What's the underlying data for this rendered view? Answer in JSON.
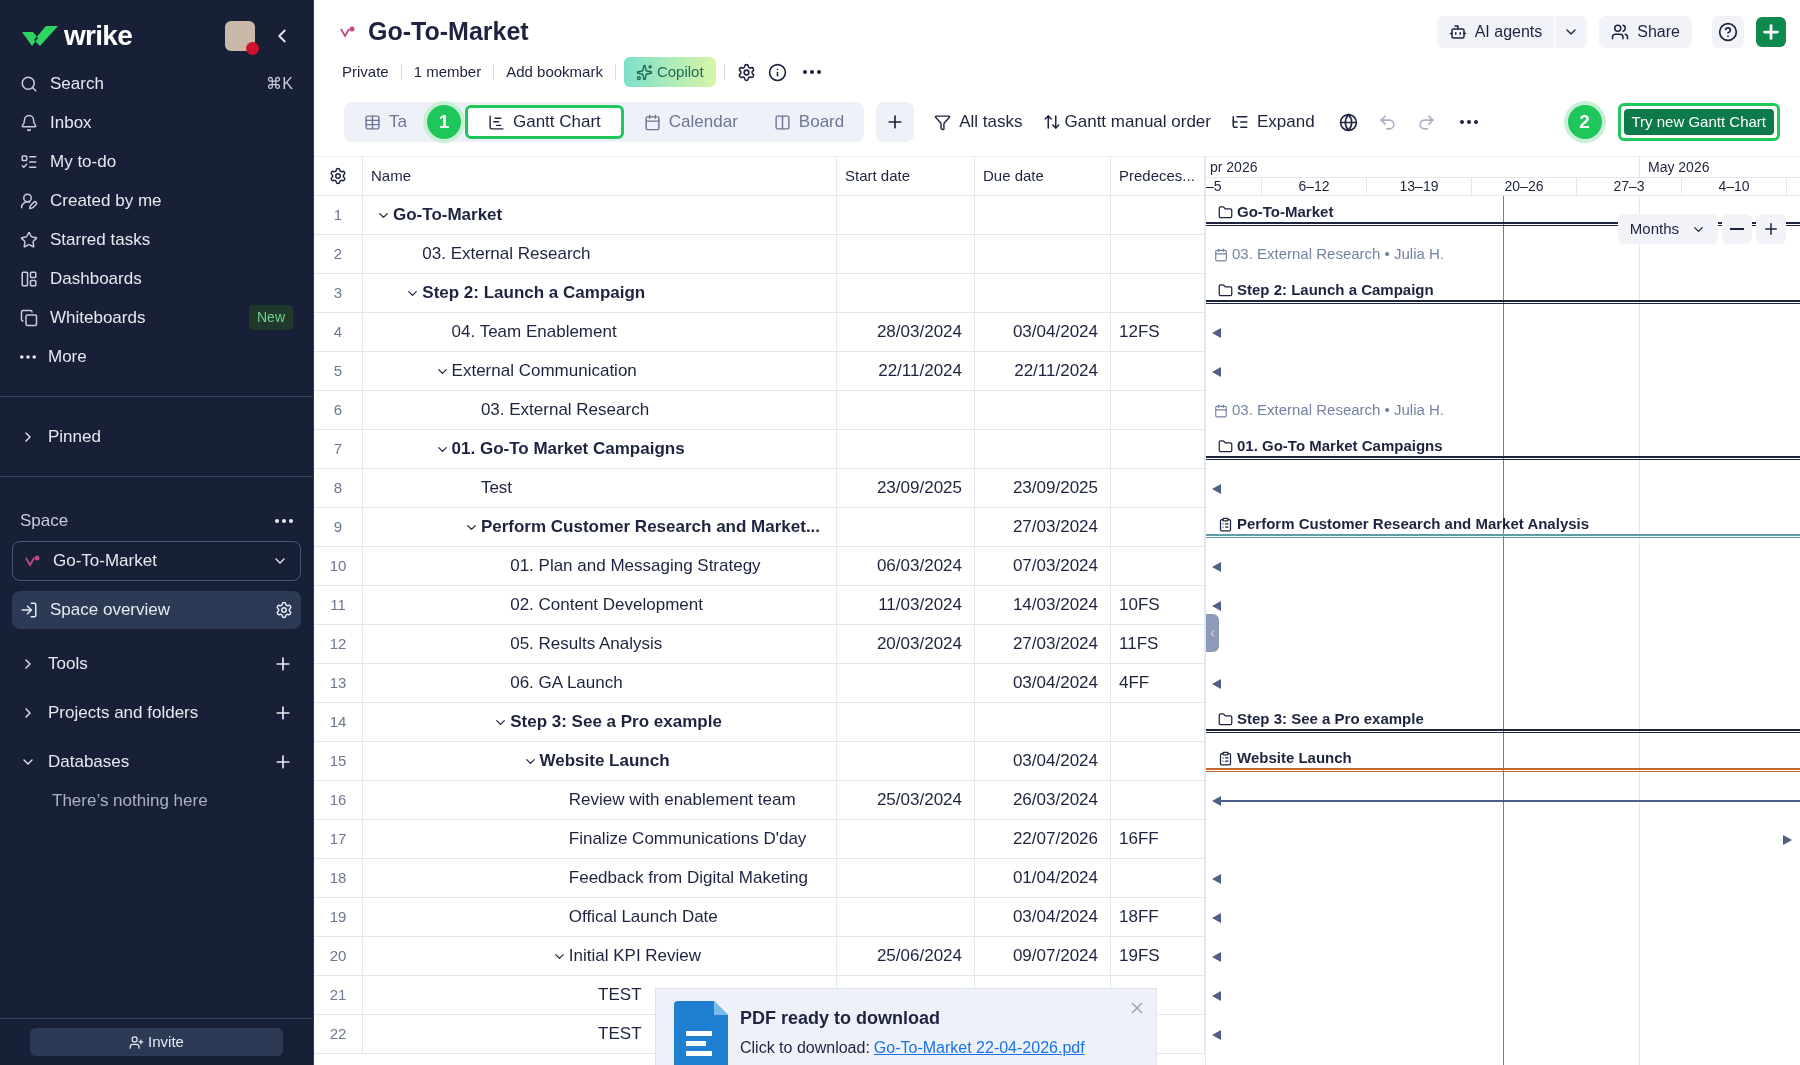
{
  "sidebar": {
    "logo": "wrike",
    "nav": [
      {
        "label": "Search",
        "shortcut": "⌘K"
      },
      {
        "label": "Inbox"
      },
      {
        "label": "My to-do"
      },
      {
        "label": "Created by me"
      },
      {
        "label": "Starred tasks"
      },
      {
        "label": "Dashboards"
      },
      {
        "label": "Whiteboards",
        "badge": "New"
      },
      {
        "label": "More"
      }
    ],
    "pinned": {
      "label": "Pinned",
      "expanded": false
    },
    "space": {
      "label": "Space",
      "current": "Go-To-Market",
      "overview": "Space overview"
    },
    "sections": [
      {
        "label": "Tools",
        "expanded": false
      },
      {
        "label": "Projects and folders",
        "expanded": false
      },
      {
        "label": "Databases",
        "expanded": true,
        "empty_text": "There’s nothing here"
      }
    ],
    "invite": "Invite"
  },
  "header": {
    "title": "Go-To-Market",
    "meta": [
      "Private",
      "1 member",
      "Add bookmark"
    ],
    "copilot": "Copilot",
    "ai_agents": "AI agents",
    "share": "Share"
  },
  "view_tabs": [
    {
      "kind": "table",
      "label": "Ta",
      "selected": false
    },
    {
      "kind": "gantt",
      "label": "Gantt Chart",
      "selected": true
    },
    {
      "kind": "calendar",
      "label": "Calendar",
      "selected": false
    },
    {
      "kind": "board",
      "label": "Board",
      "selected": false
    }
  ],
  "tour_badges": [
    "1",
    "2"
  ],
  "toolbar": {
    "filter": "All tasks",
    "sort": "Gantt manual order",
    "expand": "Expand",
    "try_new": "Try new Gantt Chart"
  },
  "table": {
    "columns": [
      "Name",
      "Start date",
      "Due date",
      "Predeces..."
    ],
    "rows": [
      {
        "num": "1",
        "name": "Go-To-Market",
        "bold": true,
        "expanded": true,
        "gantt": {
          "kind": "group",
          "label": "Go-To-Market",
          "color": "#1e2440"
        },
        "children": [
          {
            "num": "2",
            "name": "03. External Research",
            "gantt": {
              "kind": "milestone",
              "label": "03. External Research • Julia H."
            }
          },
          {
            "num": "3",
            "name": "Step 2: Launch a Campaign",
            "bold": true,
            "expanded": true,
            "gantt": {
              "kind": "group",
              "label": "Step 2: Launch a Campaign",
              "color": "#1e2440"
            },
            "children": [
              {
                "num": "4",
                "name": "04. Team Enablement",
                "start": "28/03/2024",
                "due": "03/04/2024",
                "pred": "12FS",
                "gantt": {
                  "kind": "before"
                }
              },
              {
                "num": "5",
                "name": "External Communication",
                "expanded": true,
                "start": "22/11/2024",
                "due": "22/11/2024",
                "gantt": {
                  "kind": "before"
                },
                "children": [
                  {
                    "num": "6",
                    "name": "03. External Research",
                    "gantt": {
                      "kind": "milestone",
                      "label": "03. External Research • Julia H."
                    }
                  }
                ]
              },
              {
                "num": "7",
                "name": "01. Go-To Market Campaigns",
                "bold": true,
                "expanded": true,
                "gantt": {
                  "kind": "group",
                  "label": "01. Go-To Market Campaigns",
                  "color": "#1e2440"
                },
                "children": [
                  {
                    "num": "8",
                    "name": "Test",
                    "start": "23/09/2025",
                    "due": "23/09/2025",
                    "gantt": {
                      "kind": "before"
                    }
                  },
                  {
                    "num": "9",
                    "name": "Perform Customer Research and Market...",
                    "bold": true,
                    "expanded": true,
                    "due": "27/03/2024",
                    "gantt": {
                      "kind": "task",
                      "label": "Perform Customer Research and Market Analysis",
                      "color": "#5f9ea6"
                    },
                    "children": [
                      {
                        "num": "10",
                        "name": "01. Plan and Messaging Strategy",
                        "start": "06/03/2024",
                        "due": "07/03/2024",
                        "gantt": {
                          "kind": "before"
                        }
                      },
                      {
                        "num": "11",
                        "name": "02. Content Development",
                        "start": "11/03/2024",
                        "due": "14/03/2024",
                        "pred": "10FS",
                        "gantt": {
                          "kind": "before"
                        }
                      },
                      {
                        "num": "12",
                        "name": "05. Results Analysis",
                        "start": "20/03/2024",
                        "due": "27/03/2024",
                        "pred": "11FS",
                        "gantt": {
                          "kind": "none"
                        }
                      },
                      {
                        "num": "13",
                        "name": "06. GA Launch",
                        "due": "03/04/2024",
                        "pred": "4FF",
                        "gantt": {
                          "kind": "before"
                        }
                      },
                      {
                        "num": "14",
                        "name": "Step 3: See a Pro example",
                        "bold": true,
                        "expanded": true,
                        "gantt": {
                          "kind": "group",
                          "label": "Step 3: See a Pro example",
                          "color": "#1e2440"
                        },
                        "children": [
                          {
                            "num": "15",
                            "name": "Website Launch",
                            "bold": true,
                            "expanded": true,
                            "due": "03/04/2024",
                            "gantt": {
                              "kind": "task",
                              "label": "Website Launch",
                              "color": "#c2652e"
                            },
                            "children": [
                              {
                                "num": "16",
                                "name": "Review with enablement team",
                                "start": "25/03/2024",
                                "due": "26/03/2024",
                                "gantt": {
                                  "kind": "span",
                                  "color": "#4a5f8a"
                                }
                              },
                              {
                                "num": "17",
                                "name": "Finalize Communications D'day",
                                "due": "22/07/2026",
                                "pred": "16FF",
                                "gantt": {
                                  "kind": "after"
                                }
                              },
                              {
                                "num": "18",
                                "name": "Feedback from Digital Maketing",
                                "due": "01/04/2024",
                                "gantt": {
                                  "kind": "before"
                                }
                              },
                              {
                                "num": "19",
                                "name": "Offical Launch Date",
                                "due": "03/04/2024",
                                "pred": "18FF",
                                "gantt": {
                                  "kind": "before"
                                }
                              },
                              {
                                "num": "20",
                                "name": "Initial KPI Review",
                                "expanded": true,
                                "start": "25/06/2024",
                                "due": "09/07/2024",
                                "pred": "19FS",
                                "gantt": {
                                  "kind": "before"
                                },
                                "children": [
                                  {
                                    "num": "21",
                                    "name": "TEST",
                                    "gantt": {
                                      "kind": "before"
                                    }
                                  },
                                  {
                                    "num": "22",
                                    "name": "TEST",
                                    "gantt": {
                                      "kind": "before"
                                    }
                                  }
                                ]
                              }
                            ]
                          }
                        ]
                      }
                    ]
                  }
                ]
              }
            ]
          }
        ]
      }
    ]
  },
  "gantt": {
    "months": [
      "pr 2026",
      "May 2026"
    ],
    "weeks": [
      "–5",
      "6–12",
      "13–19",
      "20–26",
      "27–3",
      "4–10"
    ],
    "scale": "Months"
  },
  "toast": {
    "title": "PDF ready to download",
    "text": "Click to download:",
    "link": "Go-To-Market 22-04-2026.pdf"
  }
}
